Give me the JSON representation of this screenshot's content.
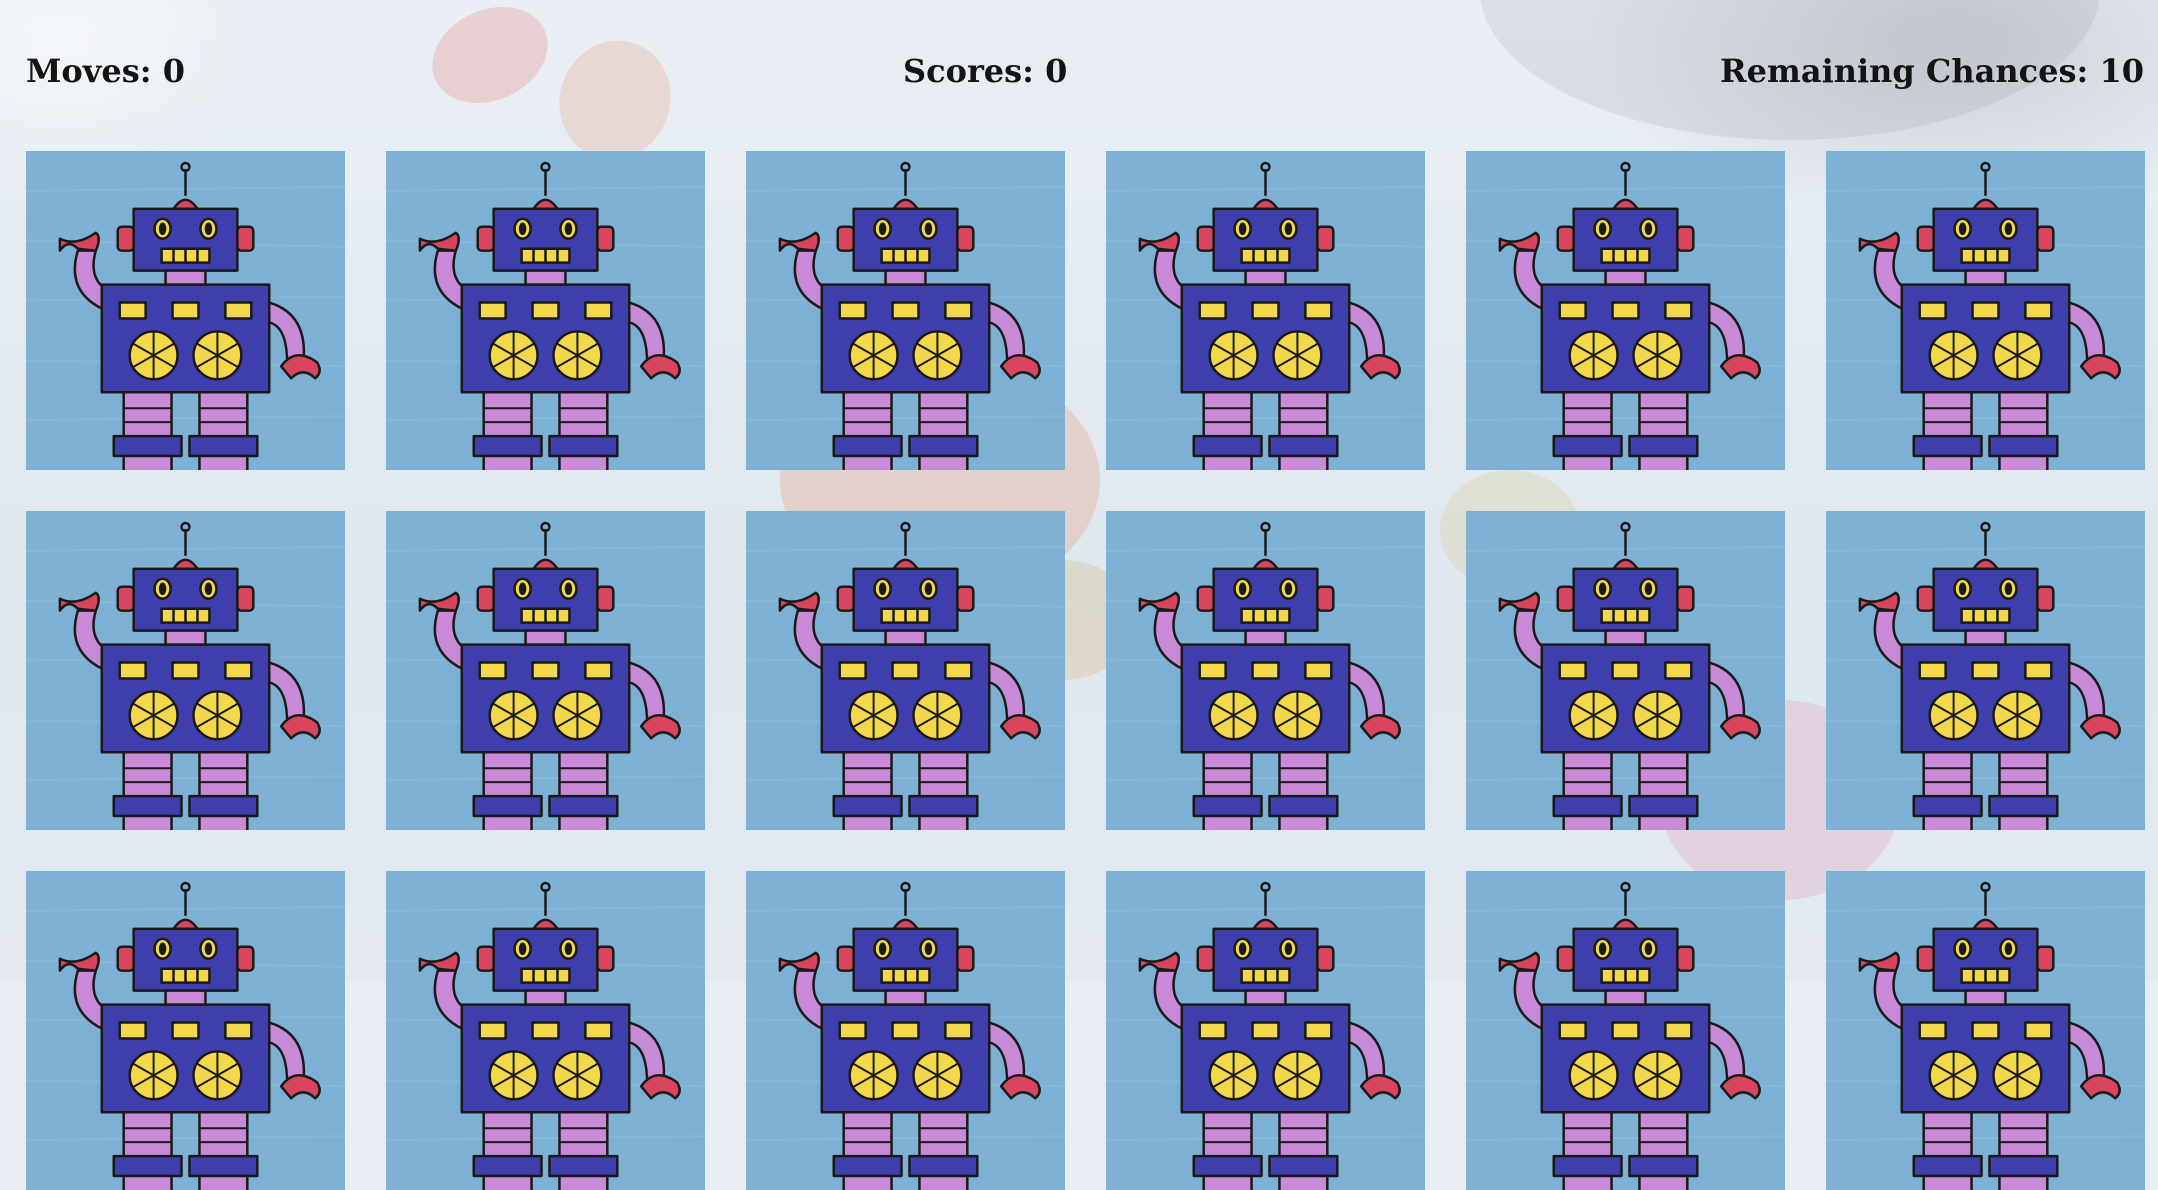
{
  "hud": {
    "moves_label": "Moves: 0",
    "scores_label": "Scores: 0",
    "chances_label": "Remaining Chances: 10"
  },
  "board": {
    "rows": 3,
    "columns": 6,
    "card_icon": "robot-card-back-icon",
    "colors": {
      "card_bg": "#7eb1d3",
      "robot_body": "#3f3fae",
      "robot_limbs": "#c98ad8",
      "robot_red": "#d9455c",
      "robot_yellow": "#f2d84a"
    }
  }
}
